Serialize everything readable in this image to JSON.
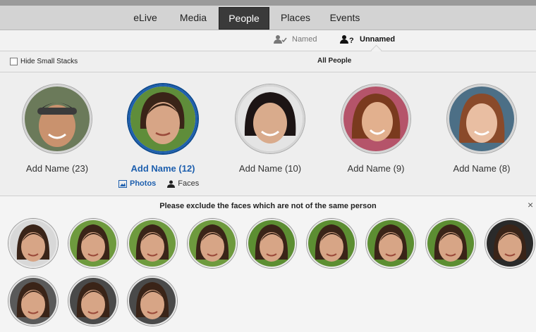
{
  "nav": {
    "tabs": [
      "eLive",
      "Media",
      "People",
      "Places",
      "Events"
    ],
    "active": "People"
  },
  "subnav": {
    "named": "Named",
    "unnamed": "Unnamed"
  },
  "filter": {
    "hide_small_stacks": "Hide Small Stacks",
    "view_title": "All People"
  },
  "people": [
    {
      "label": "Add Name (23)",
      "selected": false
    },
    {
      "label": "Add Name (12)",
      "selected": true
    },
    {
      "label": "Add Name (10)",
      "selected": false
    },
    {
      "label": "Add Name (9)",
      "selected": false
    },
    {
      "label": "Add Name (8)",
      "selected": false
    }
  ],
  "selected_tabs": {
    "photos": "Photos",
    "faces": "Faces"
  },
  "faces_panel": {
    "instruction": "Please exclude the faces which are not of the same person",
    "close": "×",
    "face_count": 12
  },
  "colors": {
    "accent": "#1d5fae",
    "active_tab": "#3a3a3a"
  }
}
